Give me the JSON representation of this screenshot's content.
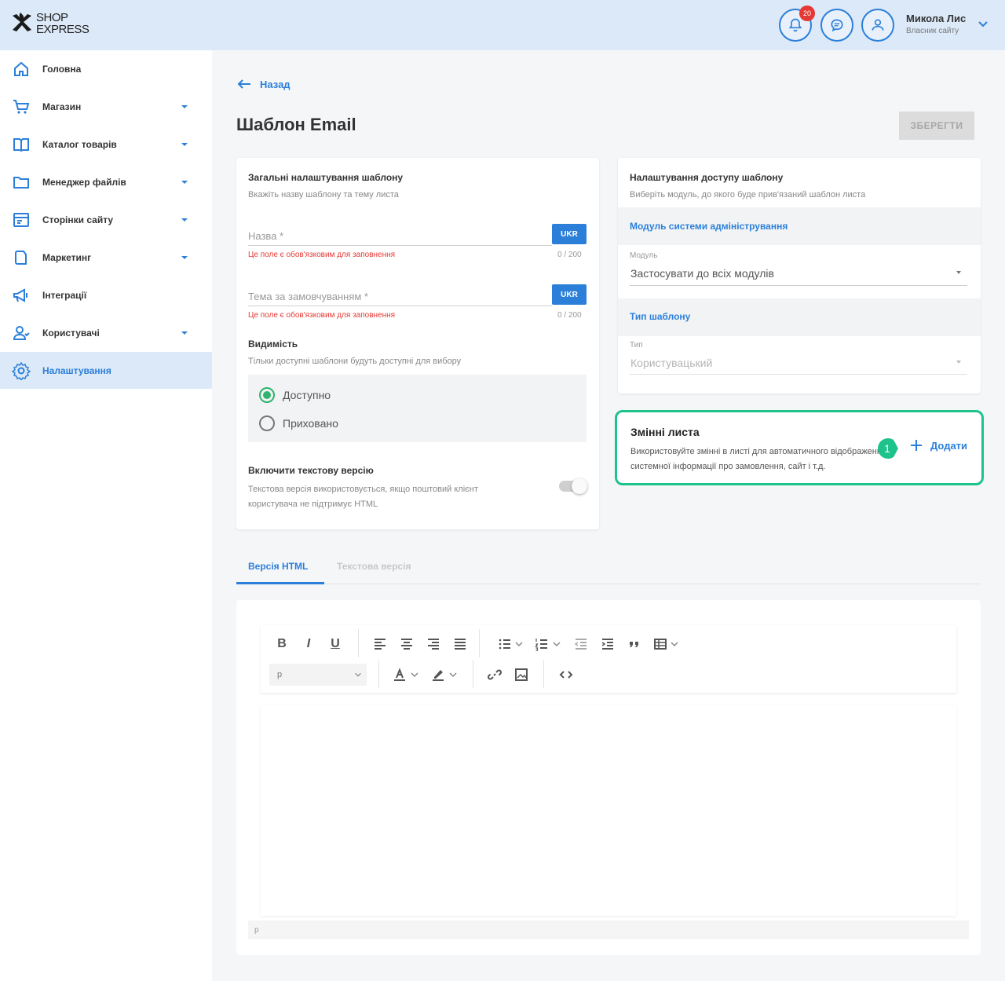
{
  "header": {
    "logo_line1": "SHOP",
    "logo_line2": "EXPRESS",
    "notifications_count": "20",
    "user_name": "Микола Лис",
    "user_role": "Власник сайту"
  },
  "sidebar": {
    "items": [
      {
        "label": "Головна",
        "icon": "home-icon"
      },
      {
        "label": "Магазин",
        "icon": "cart-icon"
      },
      {
        "label": "Каталог товарів",
        "icon": "catalog-icon"
      },
      {
        "label": "Менеджер файлів",
        "icon": "folder-icon"
      },
      {
        "label": "Сторінки сайту",
        "icon": "pages-icon"
      },
      {
        "label": "Маркетинг",
        "icon": "marketing-icon"
      },
      {
        "label": "Інтеграції",
        "icon": "integrations-icon"
      },
      {
        "label": "Користувачі",
        "icon": "users-icon"
      },
      {
        "label": "Налаштування",
        "icon": "settings-icon"
      }
    ]
  },
  "page": {
    "back_label": "Назад",
    "title": "Шаблон Email",
    "save_label": "ЗБЕРЕГТИ"
  },
  "general": {
    "title": "Загальні налаштування шаблону",
    "subtitle": "Вкажіть назву шаблону та тему листа",
    "name_label": "Назва *",
    "name_lang": "UKR",
    "name_error": "Це поле є обов'язковим для заповнення",
    "name_counter": "0 / 200",
    "subject_label": "Тема за замовчуванням *",
    "subject_lang": "UKR",
    "subject_error": "Це поле є обов'язковим для заповнення",
    "subject_counter": "0 / 200",
    "visibility_title": "Видимість",
    "visibility_sub": "Тільки доступні шаблони будуть доступні для вибору",
    "visibility_options": [
      "Доступно",
      "Приховано"
    ],
    "text_version_title": "Включити текстову версію",
    "text_version_sub": "Текстова версія використовується, якщо поштовий клієнт користувача не підтримує HTML"
  },
  "access": {
    "title": "Налаштування доступу шаблону",
    "subtitle": "Виберіть модуль, до якого буде прив'язаний шаблон листа",
    "module_section": "Модуль системи адміністрування",
    "module_label": "Модуль",
    "module_value": "Застосувати до всіх модулів",
    "type_section": "Тип шаблону",
    "type_label": "Тип",
    "type_value": "Користувацький"
  },
  "variables": {
    "title": "Змінні листа",
    "description": "Використовуйте змінні в листі для автоматичного відображення системної інформації про замовлення, сайт і т.д.",
    "step": "1",
    "add_label": "Додати",
    "highlight_color": "#1ec28b"
  },
  "tabs": [
    "Версія HTML",
    "Текстова версія"
  ],
  "editor": {
    "format_value": "p",
    "status_path": "p"
  }
}
